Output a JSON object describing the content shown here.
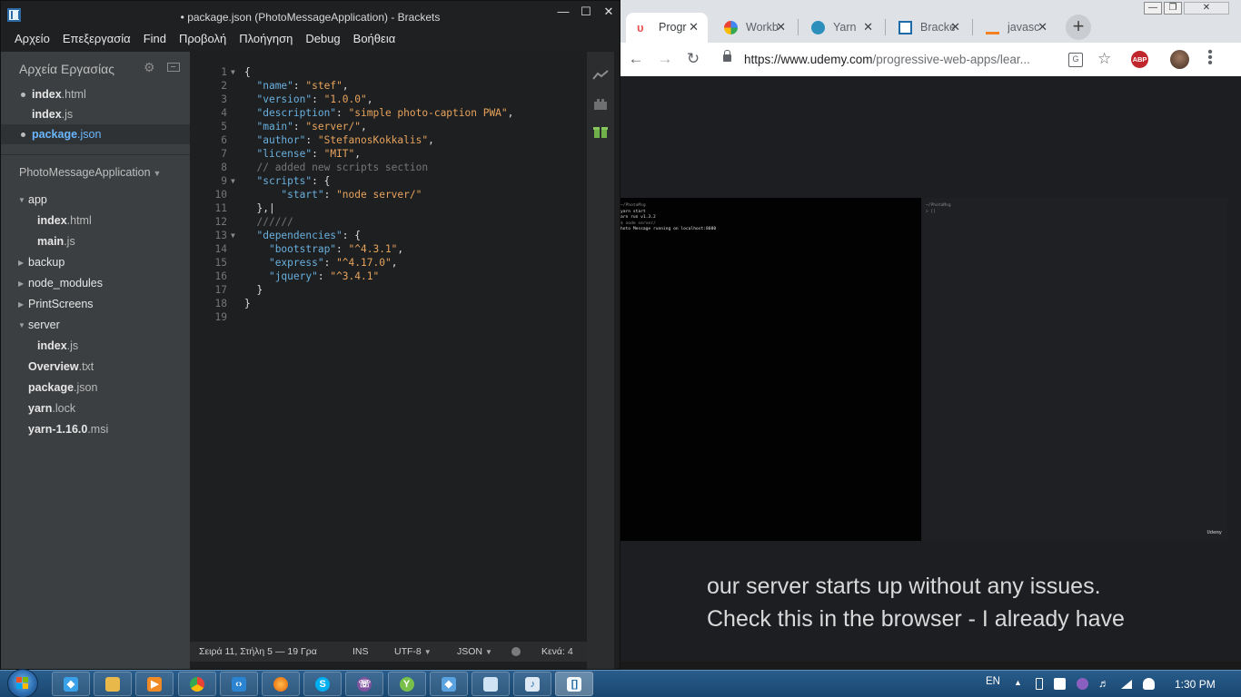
{
  "brackets": {
    "title": "• package.json (PhotoMessageApplication) - Brackets",
    "menu": [
      "Αρχείο",
      "Επεξεργασία",
      "Find",
      "Προβολή",
      "Πλοήγηση",
      "Debug",
      "Βοήθεια"
    ],
    "working_files_title": "Αρχεία Εργασίας",
    "working_files": [
      {
        "name": "index",
        "ext": ".html",
        "dirty": true,
        "active": false
      },
      {
        "name": "index",
        "ext": ".js",
        "dirty": false,
        "active": false
      },
      {
        "name": "package",
        "ext": ".json",
        "dirty": true,
        "active": true
      }
    ],
    "project_name": "PhotoMessageApplication",
    "tree": [
      {
        "name": "app",
        "ext": "",
        "kind": "folder",
        "open": true,
        "depth": 0
      },
      {
        "name": "index",
        "ext": ".html",
        "kind": "file",
        "depth": 1
      },
      {
        "name": "main",
        "ext": ".js",
        "kind": "file",
        "depth": 1
      },
      {
        "name": "backup",
        "ext": "",
        "kind": "folder",
        "open": false,
        "depth": 0
      },
      {
        "name": "node_modules",
        "ext": "",
        "kind": "folder",
        "open": false,
        "depth": 0
      },
      {
        "name": "PrintScreens",
        "ext": "",
        "kind": "folder",
        "open": false,
        "depth": 0
      },
      {
        "name": "server",
        "ext": "",
        "kind": "folder",
        "open": true,
        "depth": 0
      },
      {
        "name": "index",
        "ext": ".js",
        "kind": "file",
        "depth": 1
      },
      {
        "name": "Overview",
        "ext": ".txt",
        "kind": "file",
        "depth": 0
      },
      {
        "name": "package",
        "ext": ".json",
        "kind": "file",
        "depth": 0
      },
      {
        "name": "yarn",
        "ext": ".lock",
        "kind": "file",
        "depth": 0
      },
      {
        "name": "yarn-1.16.0",
        "ext": ".msi",
        "kind": "file",
        "depth": 0
      }
    ],
    "code_lines": [
      {
        "n": "1",
        "fold": true,
        "tokens": [
          [
            "p",
            "{"
          ]
        ]
      },
      {
        "n": "2",
        "fold": false,
        "tokens": [
          [
            "p",
            "  "
          ],
          [
            "k",
            "\"name\""
          ],
          [
            "p",
            ": "
          ],
          [
            "s",
            "\"stef\""
          ],
          [
            "p",
            ","
          ]
        ]
      },
      {
        "n": "3",
        "fold": false,
        "tokens": [
          [
            "p",
            "  "
          ],
          [
            "k",
            "\"version\""
          ],
          [
            "p",
            ": "
          ],
          [
            "s",
            "\"1.0.0\""
          ],
          [
            "p",
            ","
          ]
        ]
      },
      {
        "n": "4",
        "fold": false,
        "tokens": [
          [
            "p",
            "  "
          ],
          [
            "k",
            "\"description\""
          ],
          [
            "p",
            ": "
          ],
          [
            "s",
            "\"simple photo-caption PWA\""
          ],
          [
            "p",
            ","
          ]
        ]
      },
      {
        "n": "5",
        "fold": false,
        "tokens": [
          [
            "p",
            "  "
          ],
          [
            "k",
            "\"main\""
          ],
          [
            "p",
            ": "
          ],
          [
            "s",
            "\"server/\""
          ],
          [
            "p",
            ","
          ]
        ]
      },
      {
        "n": "6",
        "fold": false,
        "tokens": [
          [
            "p",
            "  "
          ],
          [
            "k",
            "\"author\""
          ],
          [
            "p",
            ": "
          ],
          [
            "s",
            "\"StefanosKokkalis\""
          ],
          [
            "p",
            ","
          ]
        ]
      },
      {
        "n": "7",
        "fold": false,
        "tokens": [
          [
            "p",
            "  "
          ],
          [
            "k",
            "\"license\""
          ],
          [
            "p",
            ": "
          ],
          [
            "s",
            "\"MIT\""
          ],
          [
            "p",
            ","
          ]
        ]
      },
      {
        "n": "8",
        "fold": false,
        "tokens": [
          [
            "p",
            "  "
          ],
          [
            "c",
            "// added new scripts section"
          ]
        ]
      },
      {
        "n": "9",
        "fold": true,
        "tokens": [
          [
            "p",
            "  "
          ],
          [
            "k",
            "\"scripts\""
          ],
          [
            "p",
            ": {"
          ]
        ]
      },
      {
        "n": "10",
        "fold": false,
        "tokens": [
          [
            "p",
            "      "
          ],
          [
            "k",
            "\"start\""
          ],
          [
            "p",
            ": "
          ],
          [
            "s",
            "\"node server/\""
          ]
        ]
      },
      {
        "n": "11",
        "fold": false,
        "tokens": [
          [
            "p",
            "  },|"
          ]
        ]
      },
      {
        "n": "12",
        "fold": false,
        "tokens": [
          [
            "p",
            "  "
          ],
          [
            "c",
            "//////"
          ]
        ]
      },
      {
        "n": "13",
        "fold": true,
        "tokens": [
          [
            "p",
            "  "
          ],
          [
            "k",
            "\"dependencies\""
          ],
          [
            "p",
            ": {"
          ]
        ]
      },
      {
        "n": "14",
        "fold": false,
        "tokens": [
          [
            "p",
            "    "
          ],
          [
            "k",
            "\"bootstrap\""
          ],
          [
            "p",
            ": "
          ],
          [
            "s",
            "\"^4.3.1\""
          ],
          [
            "p",
            ","
          ]
        ]
      },
      {
        "n": "15",
        "fold": false,
        "tokens": [
          [
            "p",
            "    "
          ],
          [
            "k",
            "\"express\""
          ],
          [
            "p",
            ": "
          ],
          [
            "s",
            "\"^4.17.0\""
          ],
          [
            "p",
            ","
          ]
        ]
      },
      {
        "n": "16",
        "fold": false,
        "tokens": [
          [
            "p",
            "    "
          ],
          [
            "k",
            "\"jquery\""
          ],
          [
            "p",
            ": "
          ],
          [
            "s",
            "\"^3.4.1\""
          ]
        ]
      },
      {
        "n": "17",
        "fold": false,
        "tokens": [
          [
            "p",
            "  }"
          ]
        ]
      },
      {
        "n": "18",
        "fold": false,
        "tokens": [
          [
            "p",
            "}"
          ]
        ]
      },
      {
        "n": "19",
        "fold": false,
        "tokens": []
      }
    ],
    "status": {
      "position": "Σειρά 11, Στήλη 5 — 19 Γρα",
      "mode": "INS",
      "encoding": "UTF-8",
      "language": "JSON",
      "indent": "Κενά: 4"
    }
  },
  "chrome": {
    "tabs": [
      {
        "label": "Progr",
        "icon": "udemy-icon",
        "active": true
      },
      {
        "label": "Workb",
        "icon": "workbox-icon",
        "active": false
      },
      {
        "label": "Yarn",
        "icon": "yarn-icon",
        "active": false
      },
      {
        "label": "Bracke",
        "icon": "brackets-icon",
        "active": false
      },
      {
        "label": "javasc",
        "icon": "stackoverflow-icon",
        "active": false
      }
    ],
    "url_host": "https://www.udemy.com",
    "url_path": "/progressive-web-apps/lear...",
    "video": {
      "terminal_left": [
        "~/PhotoMsg",
        " yarn start",
        "arn run v1.3.2",
        "$ node server/",
        "hoto Message running on localhost:8080"
      ],
      "terminal_right": [
        "~/PhotoMsg",
        "> []"
      ],
      "watermark": "Udemy",
      "captions": [
        "our server starts up without any issues.",
        "Check this in the browser - I already have"
      ]
    }
  },
  "taskbar": {
    "apps": [
      "explorer-alt-icon",
      "folder-icon",
      "media-player-icon",
      "chrome-icon",
      "vscode-icon",
      "firefox-icon",
      "skype-icon",
      "viber-icon",
      "yarn-app-icon",
      "brackets-extra-icon",
      "notepad-icon",
      "paint-icon",
      "brackets-taskbar-icon"
    ],
    "language": "EN",
    "time": "1:30 PM"
  },
  "colors": {
    "keyword": "#6ab0de",
    "string": "#e8a35c",
    "comment": "#767676",
    "active_file": "#6bb7ff"
  }
}
